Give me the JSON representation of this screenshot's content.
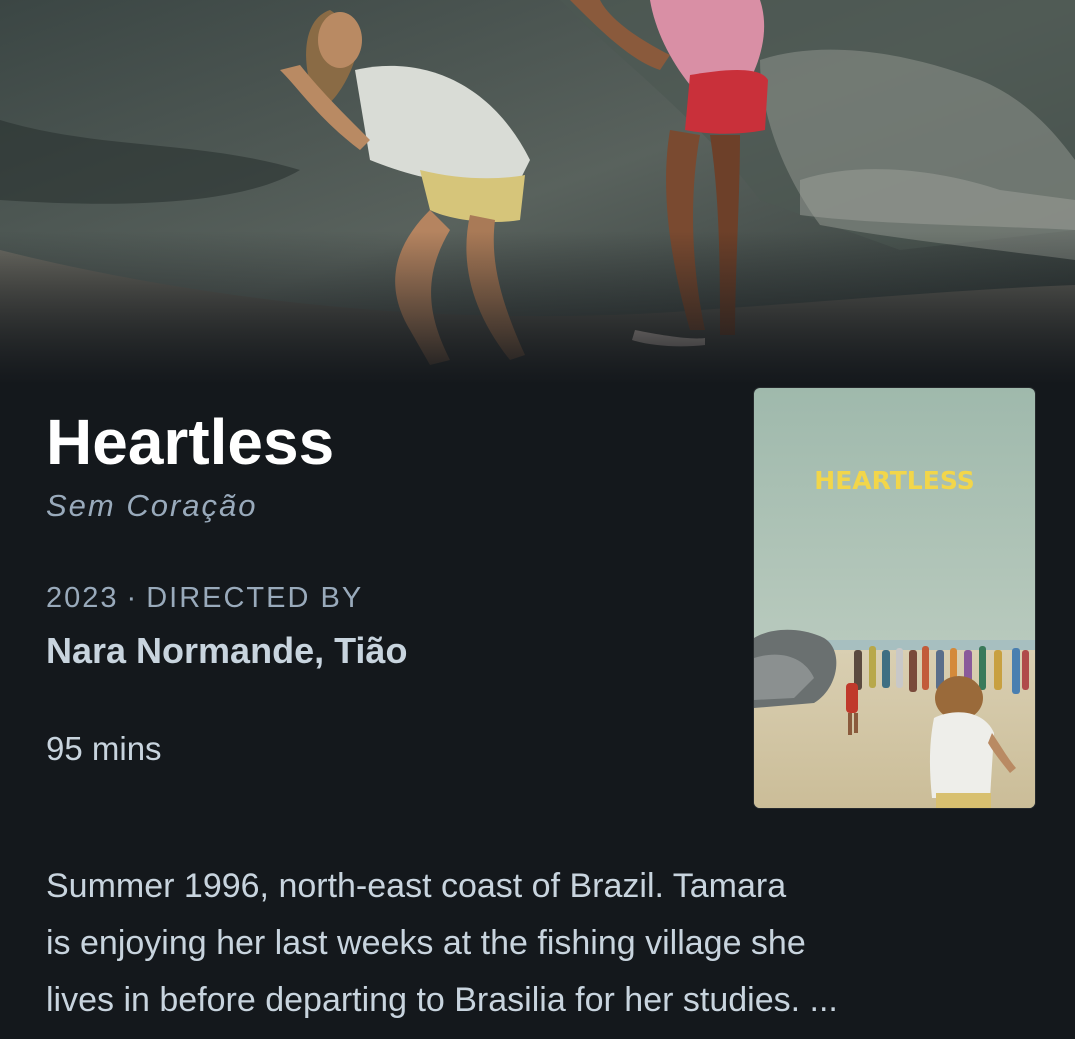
{
  "film": {
    "title": "Heartless",
    "original_title": "Sem Coração",
    "year": "2023",
    "separator": "·",
    "directed_by_label": "DIRECTED BY",
    "directors": "Nara Normande, Tião",
    "runtime": "95 mins",
    "synopsis_lines": [
      "Summer 1996, north-east coast of Brazil. Tamara",
      "is enjoying her last weeks at the fishing village she",
      "lives in before departing to Brasilia for her studies. ..."
    ]
  },
  "poster": {
    "title_text": "HEARTLESS"
  },
  "colors": {
    "background": "#14181c",
    "poster_title": "#f2d64a"
  }
}
